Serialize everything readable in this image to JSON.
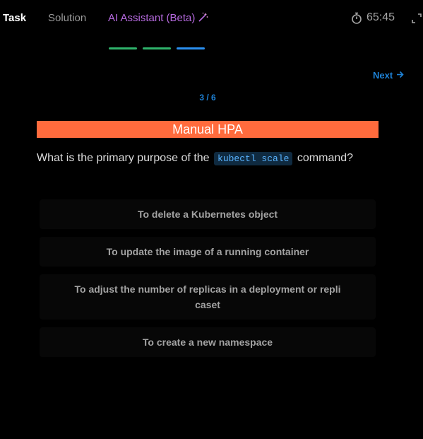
{
  "tabs": {
    "task": "Task",
    "solution": "Solution",
    "ai_assistant": "AI Assistant (Beta)"
  },
  "timer": "65:45",
  "progress_colors": [
    "#2fb36b",
    "#2fb36b",
    "#2a8ff0"
  ],
  "next_label": "Next",
  "counter": "3 / 6",
  "question": {
    "title": "Manual HPA",
    "prefix": "What is the primary purpose of the",
    "code": "kubectl scale",
    "suffix": "command?"
  },
  "options": [
    "To delete a Kubernetes object",
    "To update the image of a running container",
    "To adjust the number of replicas in a deployment or repli caset",
    "To create a new namespace"
  ],
  "colors": {
    "accent_orange": "#ff6b3d",
    "accent_blue": "#1e82d6",
    "ai_purple": "#b66adf"
  }
}
